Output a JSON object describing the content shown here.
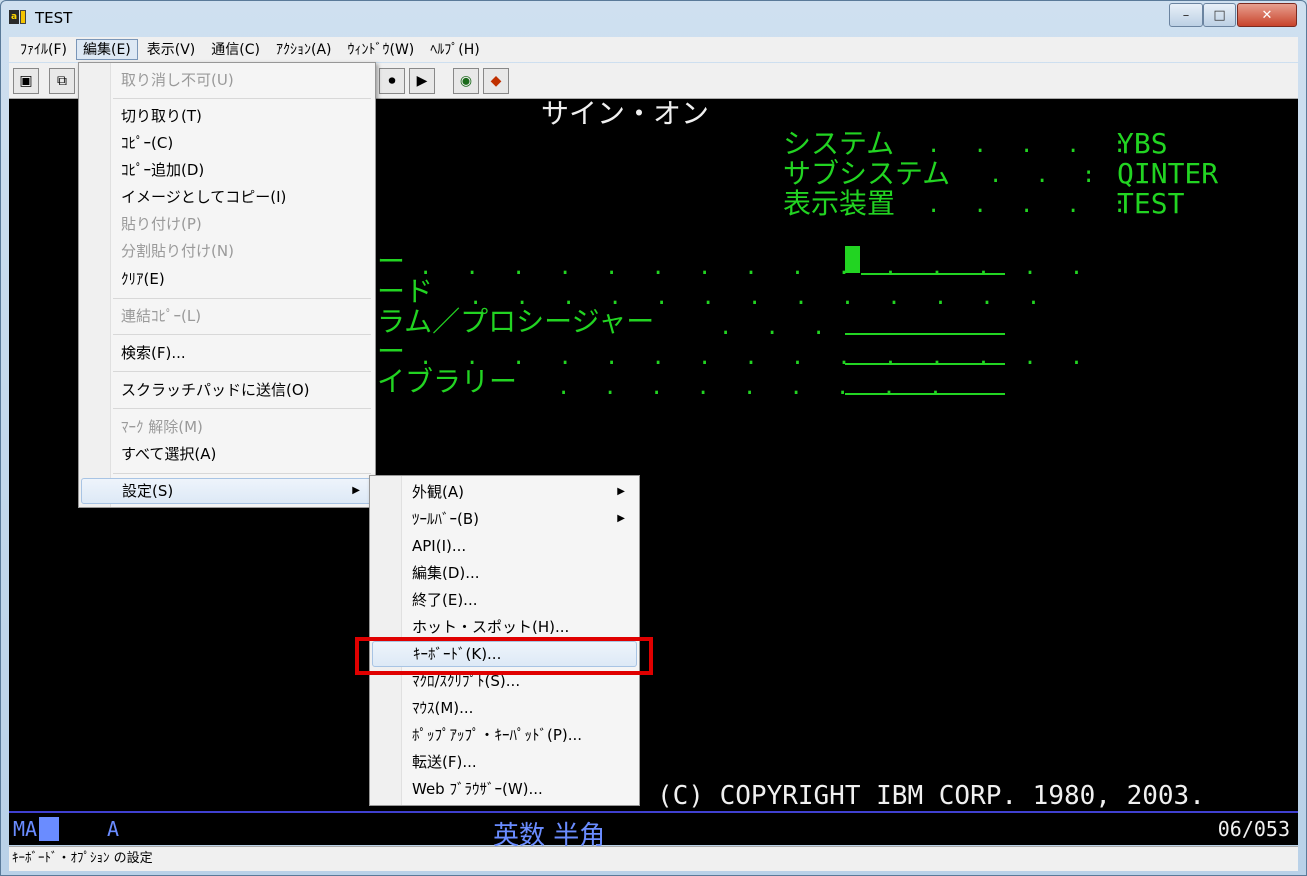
{
  "window": {
    "title": "TEST",
    "app_icon": "ibm-pcomm-icon"
  },
  "controls": {
    "minimize": "–",
    "maximize": "□",
    "close": "✕"
  },
  "menubar": [
    {
      "label": "ﾌｧｲﾙ(F)"
    },
    {
      "label": "編集(E)"
    },
    {
      "label": "表示(V)"
    },
    {
      "label": "通信(C)"
    },
    {
      "label": "ｱｸｼｮﾝ(A)"
    },
    {
      "label": "ｳｨﾝﾄﾞｳ(W)"
    },
    {
      "label": "ﾍﾙﾌﾟ(H)"
    }
  ],
  "toolbar_icons": [
    "print-screen-icon",
    "copy-icon",
    "record-macro-icon",
    "play-macro-icon",
    "world-icon",
    "tag-icon"
  ],
  "edit_menu": {
    "undo": "取り消し不可(U)",
    "cut": "切り取り(T)",
    "copy": "ｺﾋﾟｰ(C)",
    "copy_append": "ｺﾋﾟｰ追加(D)",
    "copy_image": "イメージとしてコピー(I)",
    "paste": "貼り付け(P)",
    "paste_split": "分割貼り付け(N)",
    "clear": "ｸﾘｱ(E)",
    "linked_copy": "連結ｺﾋﾟｰ(L)",
    "find": "検索(F)...",
    "scratchpad": "スクラッチパッドに送信(O)",
    "unmark": "ﾏｰｸ 解除(M)",
    "select_all": "すべて選択(A)",
    "settings": "設定(S)"
  },
  "settings_menu": {
    "appearance": "外観(A)",
    "toolbar": "ﾂｰﾙﾊﾞｰ(B)",
    "api": "API(I)...",
    "edit": "編集(D)...",
    "exit": "終了(E)...",
    "hotspot": "ホット・スポット(H)...",
    "keyboard": "ｷｰﾎﾞｰﾄﾞ(K)...",
    "macro": "ﾏｸﾛ/ｽｸﾘﾌﾟﾄ(S)...",
    "mouse": "ﾏｳｽ(M)...",
    "popup_keypad": "ﾎﾟｯﾌﾟｱｯﾌﾟ・ｷｰﾊﾟｯﾄﾞ(P)...",
    "transfer": "転送(F)...",
    "web_browser": "Web ﾌﾞﾗｳｻﾞｰ(W)..."
  },
  "screen": {
    "heading": "サイン・オン",
    "system_label": "システム",
    "system_value": "YBS",
    "subsystem_label": "サブシステム",
    "subsystem_value": "QINTER",
    "display_label": "表示装置",
    "display_value": "TEST",
    "row1": "ー",
    "row2": "ード",
    "row3": "ラム／プロシージャー",
    "row4": "ー",
    "row5": "イブラリー",
    "copyright": "(C) COPYRIGHT IBM CORP. 1980, 2003."
  },
  "oia": {
    "ma": "MA",
    "a": "A",
    "ime": "英数 半角",
    "cursor_pos": "06/053"
  },
  "statusbar": "ｷｰﾎﾞｰﾄﾞ・ｵﾌﾟｼｮﾝ の設定"
}
